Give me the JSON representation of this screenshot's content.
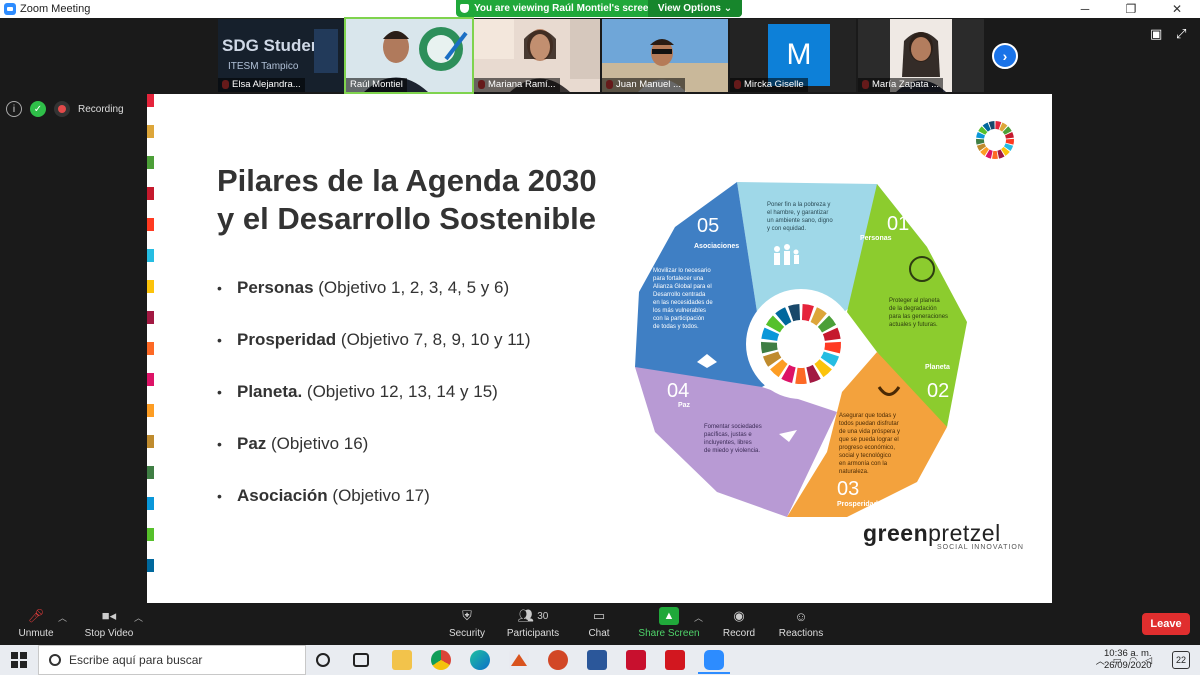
{
  "window": {
    "title": "Zoom Meeting"
  },
  "share_banner": {
    "message": "You are viewing Raúl Montiel's screen",
    "view_options_label": "View Options ⌄"
  },
  "participants": [
    {
      "name": "Elsa Alejandra..."
    },
    {
      "name": "Raúl Montiel"
    },
    {
      "name": "Mariana Ramí..."
    },
    {
      "name": "Juan Manuel ..."
    },
    {
      "name": "Mircka Giselle",
      "initial": "M"
    },
    {
      "name": "María Zapata ..."
    }
  ],
  "thumb_text": {
    "sdg_banner": "SDG Studen",
    "itesm": "ITESM Tampico"
  },
  "status": {
    "recording_label": "Recording"
  },
  "slide": {
    "title_line1": "Pilares de la Agenda 2030",
    "title_line2": "y el Desarrollo Sostenible",
    "bullets": [
      {
        "bold": "Personas",
        "rest": " (Objetivo 1, 2, 3, 4, 5 y 6)"
      },
      {
        "bold": "Prosperidad",
        "rest": " (Objetivo 7, 8, 9, 10 y 11)"
      },
      {
        "bold": "Planeta.",
        "rest": " (Objetivo 12, 13, 14 y 15)"
      },
      {
        "bold": "Paz",
        "rest": " (Objetivo 16)"
      },
      {
        "bold": "Asociación",
        "rest": " (Objetivo 17)"
      }
    ],
    "wheel": {
      "p1_num": "01",
      "p1_name": "Personas",
      "p1_text": [
        "Poner fin a la pobreza y",
        "el hambre, y garantizar",
        "un ambiente sano, digno",
        "y con equidad."
      ],
      "p2_num": "02",
      "p2_name": "Planeta",
      "p2_text": [
        "Proteger al planeta",
        "de la degradación",
        "para las generaciones",
        "actuales y futuras."
      ],
      "p3_num": "03",
      "p3_name": "Prosperidad",
      "p3_text": [
        "Asegurar que todas y",
        "todos puedan disfrutar",
        "de una vida próspera y",
        "que se pueda lograr el",
        "progreso económico,",
        "social y tecnológico",
        "en armonía con la",
        "naturaleza."
      ],
      "p4_num": "04",
      "p4_name": "Paz",
      "p4_text": [
        "Fomentar sociedades",
        "pacíficas, justas e",
        "incluyentes, libres",
        "de miedo y violencia."
      ],
      "p5_num": "05",
      "p5_name": "Asociaciones",
      "p5_text": [
        "Movilizar lo necesario",
        "para fortalecer una",
        "Alianza Global para el",
        "Desarrollo centrada",
        "en las necesidades de",
        "los más vulnerables",
        "con la participación",
        "de todas y todos."
      ],
      "colors": {
        "p1": "#9fd8e8",
        "p2": "#8ccc2e",
        "p3": "#f3a23d",
        "p4": "#b89ad4",
        "p5": "#3f7fc4"
      }
    },
    "brand_bold": "green",
    "brand_light": "pretzel",
    "brand_sub": "SOCIAL INNOVATION"
  },
  "toolbar": {
    "unmute": "Unmute",
    "stop_video": "Stop Video",
    "security": "Security",
    "participants": "Participants",
    "participants_count": "30",
    "chat": "Chat",
    "share_screen": "Share Screen",
    "record": "Record",
    "reactions": "Reactions",
    "leave": "Leave"
  },
  "taskbar": {
    "search_placeholder": "Escribe aquí para buscar",
    "time": "10:36 a. m.",
    "date": "26/09/2020",
    "notifications": "22"
  }
}
